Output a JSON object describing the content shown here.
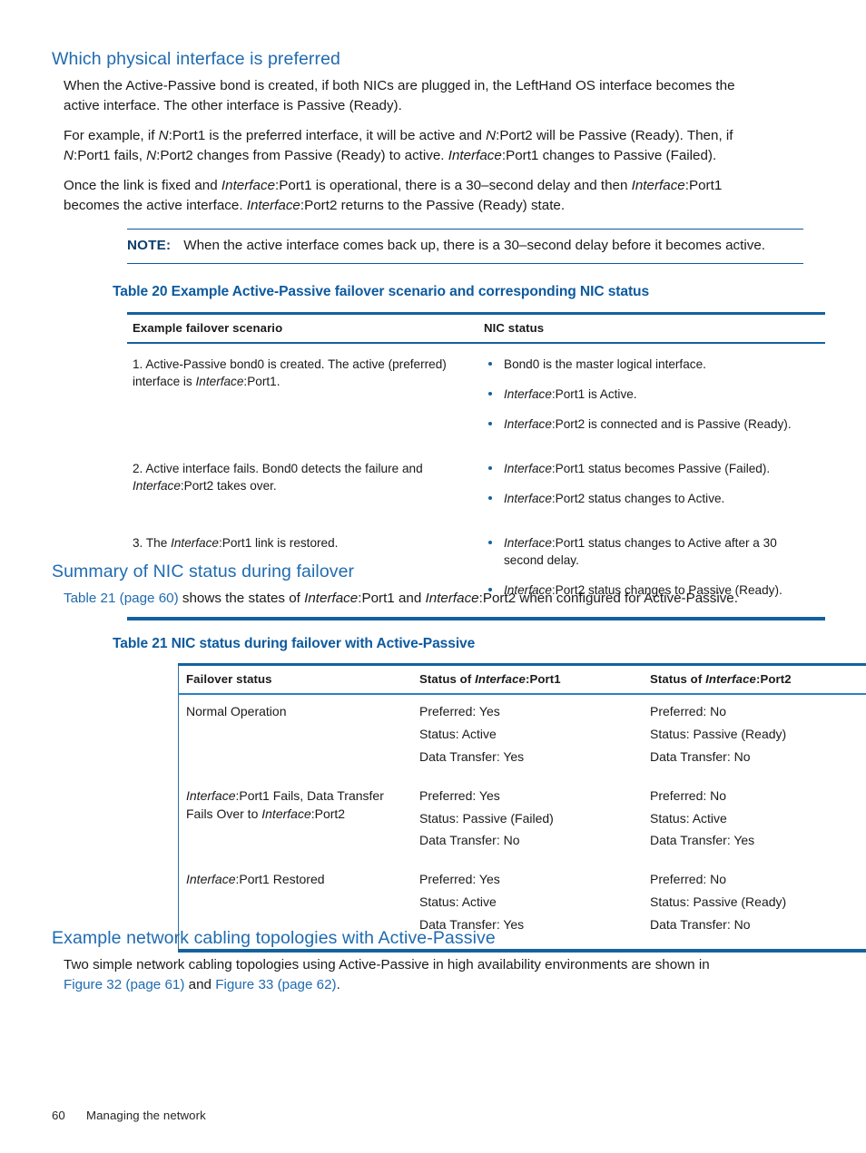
{
  "colors": {
    "heading_blue": "#1f6bb0",
    "caption_blue": "#0d5a9e",
    "rule_blue": "#15619e",
    "note_label_blue": "#0d3e6e",
    "body_text": "#1a1a1a"
  },
  "section1": {
    "heading": "Which physical interface is preferred",
    "paragraphs": [
      {
        "parts": [
          {
            "t": "When the Active-Passive bond is created, if both NICs are plugged in, the LeftHand OS interface becomes the active interface. The other interface is Passive (Ready).",
            "style": "normal"
          }
        ]
      },
      {
        "parts": [
          {
            "t": "For example, if ",
            "style": "normal"
          },
          {
            "t": "N",
            "style": "italic"
          },
          {
            "t": ":Port1 is the preferred interface, it will be active and ",
            "style": "normal"
          },
          {
            "t": "N",
            "style": "italic"
          },
          {
            "t": ":Port2 will be Passive (Ready). Then, if ",
            "style": "normal"
          },
          {
            "t": "N",
            "style": "italic"
          },
          {
            "t": ":Port1 fails, ",
            "style": "normal"
          },
          {
            "t": "N",
            "style": "italic"
          },
          {
            "t": ":Port2 changes from Passive (Ready) to active. ",
            "style": "normal"
          },
          {
            "t": "Interface",
            "style": "italic"
          },
          {
            "t": ":Port1 changes to Passive (Failed).",
            "style": "normal"
          }
        ]
      },
      {
        "parts": [
          {
            "t": "Once the link is fixed and ",
            "style": "normal"
          },
          {
            "t": "Interface",
            "style": "italic"
          },
          {
            "t": ":Port1 is operational, there is a 30–second delay and then ",
            "style": "normal"
          },
          {
            "t": "Interface",
            "style": "italic"
          },
          {
            "t": ":Port1 becomes the active interface. ",
            "style": "normal"
          },
          {
            "t": "Interface",
            "style": "italic"
          },
          {
            "t": ":Port2 returns to the Passive (Ready) state.",
            "style": "normal"
          }
        ]
      }
    ]
  },
  "note": {
    "label": "NOTE:",
    "text": "When the active interface comes back up, there is a 30–second delay before it becomes active."
  },
  "table20": {
    "caption": "Table 20 Example Active-Passive failover scenario and corresponding NIC status",
    "columns": [
      "Example failover scenario",
      "NIC status"
    ],
    "rows": [
      {
        "scenario": [
          {
            "t": "1. Active-Passive bond0 is created. The active (preferred) interface is ",
            "style": "normal"
          },
          {
            "t": "Interface",
            "style": "italic"
          },
          {
            "t": ":Port1.",
            "style": "normal"
          }
        ],
        "status": [
          [
            {
              "t": "Bond0 is the master logical interface.",
              "style": "normal"
            }
          ],
          [
            {
              "t": "Interface",
              "style": "italic"
            },
            {
              "t": ":Port1 is Active.",
              "style": "normal"
            }
          ],
          [
            {
              "t": "Interface",
              "style": "italic"
            },
            {
              "t": ":Port2 is connected and is Passive (Ready).",
              "style": "normal"
            }
          ]
        ]
      },
      {
        "scenario": [
          {
            "t": "2. Active interface fails. Bond0 detects the failure and ",
            "style": "normal"
          },
          {
            "t": "Interface",
            "style": "italic"
          },
          {
            "t": ":Port2 takes over.",
            "style": "normal"
          }
        ],
        "status": [
          [
            {
              "t": "Interface",
              "style": "italic"
            },
            {
              "t": ":Port1 status becomes Passive (Failed).",
              "style": "normal"
            }
          ],
          [
            {
              "t": "Interface",
              "style": "italic"
            },
            {
              "t": ":Port2 status changes to Active.",
              "style": "normal"
            }
          ]
        ]
      },
      {
        "scenario": [
          {
            "t": "3. The ",
            "style": "normal"
          },
          {
            "t": "Interface",
            "style": "italic"
          },
          {
            "t": ":Port1 link is restored.",
            "style": "normal"
          }
        ],
        "status": [
          [
            {
              "t": "Interface",
              "style": "italic"
            },
            {
              "t": ":Port1 status changes to Active after a 30 second delay.",
              "style": "normal"
            }
          ],
          [
            {
              "t": "Interface",
              "style": "italic"
            },
            {
              "t": ":Port2 status changes to Passive (Ready).",
              "style": "normal"
            }
          ]
        ]
      }
    ]
  },
  "section2": {
    "heading": "Summary of NIC status during failover",
    "paragraph": [
      {
        "t": "Table 21 (page 60)",
        "style": "xref"
      },
      {
        "t": " shows the states of ",
        "style": "normal"
      },
      {
        "t": "Interface",
        "style": "italic"
      },
      {
        "t": ":Port1 and ",
        "style": "normal"
      },
      {
        "t": "Interface",
        "style": "italic"
      },
      {
        "t": ":Port2 when configured for Active-Passive.",
        "style": "normal"
      }
    ]
  },
  "table21": {
    "caption": "Table 21 NIC status during failover with Active-Passive",
    "columns": [
      [
        {
          "t": "Failover status",
          "style": "normal"
        }
      ],
      [
        {
          "t": "Status of ",
          "style": "normal"
        },
        {
          "t": "Interface",
          "style": "italic"
        },
        {
          "t": ":Port1",
          "style": "normal"
        }
      ],
      [
        {
          "t": "Status of ",
          "style": "normal"
        },
        {
          "t": "Interface",
          "style": "italic"
        },
        {
          "t": ":Port2",
          "style": "normal"
        }
      ]
    ],
    "rows": [
      {
        "failover": [
          {
            "t": "Normal Operation",
            "style": "normal"
          }
        ],
        "port1": [
          "Preferred: Yes",
          "Status: Active",
          "Data Transfer: Yes"
        ],
        "port2": [
          "Preferred: No",
          "Status: Passive (Ready)",
          "Data Transfer: No"
        ]
      },
      {
        "failover": [
          {
            "t": "Interface",
            "style": "italic"
          },
          {
            "t": ":Port1 Fails, Data Transfer Fails Over to ",
            "style": "normal"
          },
          {
            "t": "Interface",
            "style": "italic"
          },
          {
            "t": ":Port2",
            "style": "normal"
          }
        ],
        "port1": [
          "Preferred: Yes",
          "Status: Passive (Failed)",
          "Data Transfer: No"
        ],
        "port2": [
          "Preferred: No",
          "Status: Active",
          "Data Transfer: Yes"
        ]
      },
      {
        "failover": [
          {
            "t": "Interface",
            "style": "italic"
          },
          {
            "t": ":Port1 Restored",
            "style": "normal"
          }
        ],
        "port1": [
          "Preferred: Yes",
          "Status: Active",
          "Data Transfer: Yes"
        ],
        "port2": [
          "Preferred: No",
          "Status: Passive (Ready)",
          "Data Transfer: No"
        ]
      }
    ]
  },
  "section3": {
    "heading": "Example network cabling topologies with Active-Passive",
    "paragraph": [
      {
        "t": "Two simple network cabling topologies using Active-Passive in high availability environments are shown in ",
        "style": "normal"
      },
      {
        "t": "Figure 32 (page 61)",
        "style": "xref"
      },
      {
        "t": " and ",
        "style": "normal"
      },
      {
        "t": "Figure 33 (page 62)",
        "style": "xref"
      },
      {
        "t": ".",
        "style": "normal"
      }
    ]
  },
  "footer": {
    "page_number": "60",
    "chapter": "Managing the network"
  }
}
